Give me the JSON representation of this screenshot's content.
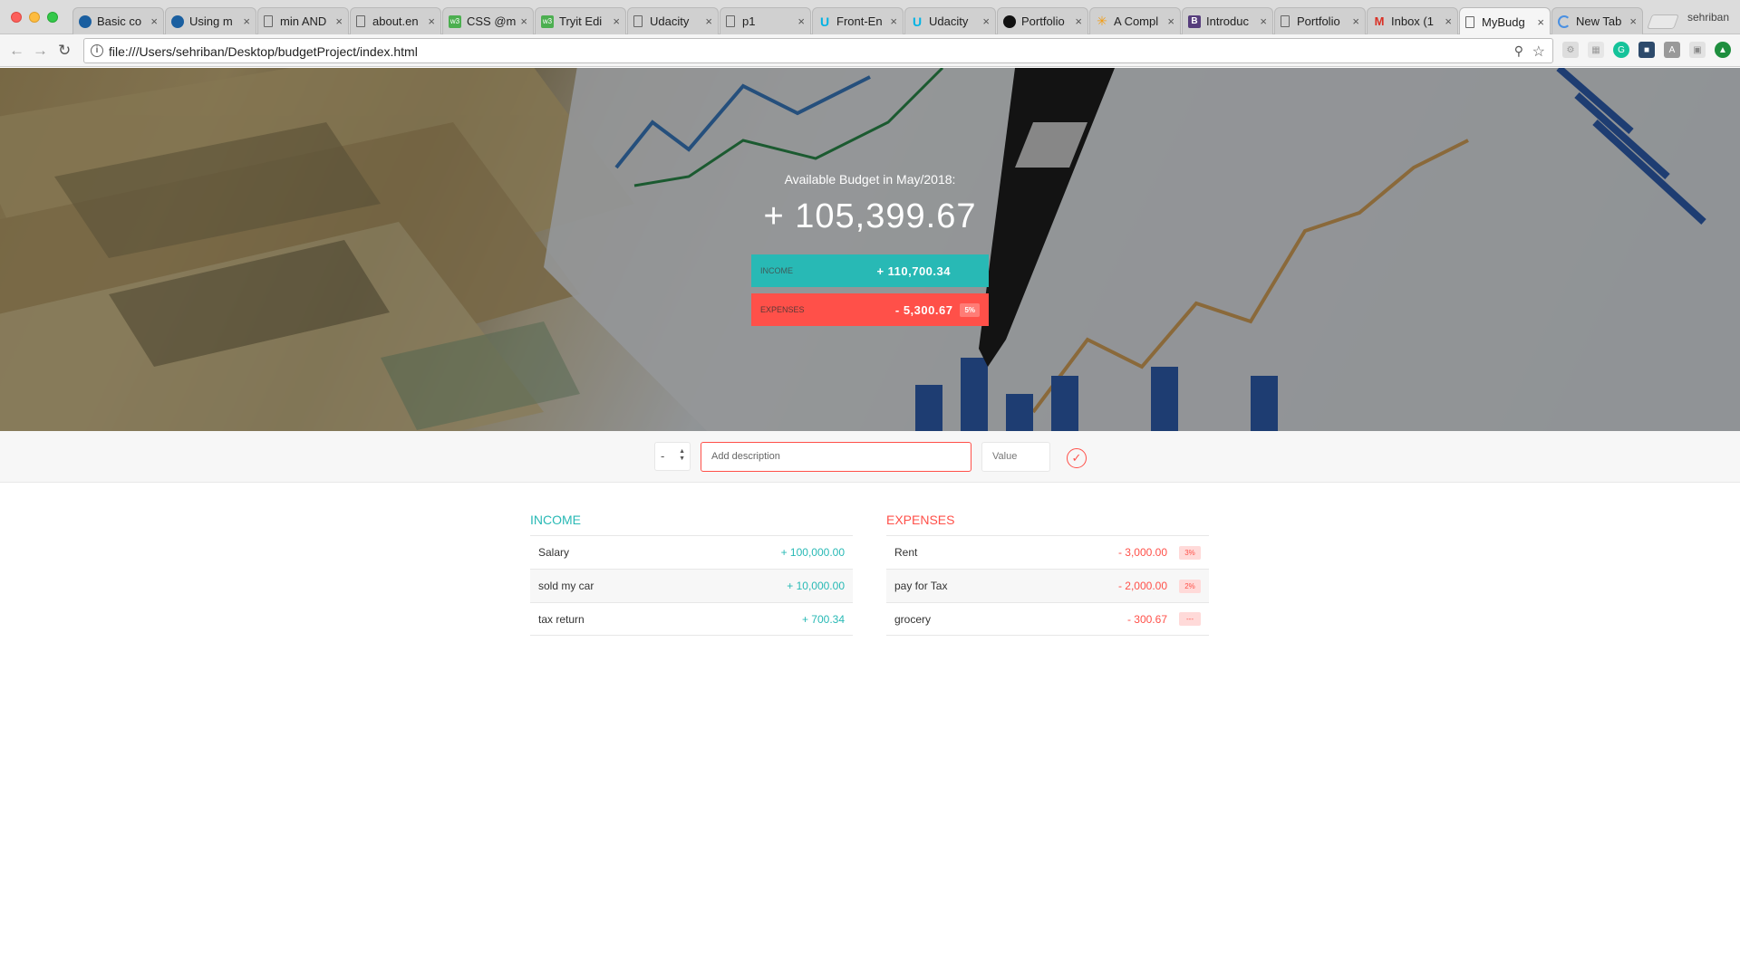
{
  "browser": {
    "tabs": [
      {
        "title": "Basic co",
        "icon": "bird-icon"
      },
      {
        "title": "Using m",
        "icon": "bird-icon"
      },
      {
        "title": "min AND",
        "icon": "document-icon"
      },
      {
        "title": "about.en",
        "icon": "document-icon"
      },
      {
        "title": "CSS @m",
        "icon": "w3schools-icon"
      },
      {
        "title": "Tryit Edi",
        "icon": "w3schools-icon"
      },
      {
        "title": "Udacity",
        "icon": "document-icon"
      },
      {
        "title": "p1",
        "icon": "document-icon"
      },
      {
        "title": "Front-En",
        "icon": "udacity-icon"
      },
      {
        "title": "Udacity",
        "icon": "udacity-icon"
      },
      {
        "title": "Portfolio",
        "icon": "github-icon"
      },
      {
        "title": "A Compl",
        "icon": "star-icon"
      },
      {
        "title": "Introduc",
        "icon": "bootstrap-icon"
      },
      {
        "title": "Portfolio",
        "icon": "document-icon"
      },
      {
        "title": "Inbox (1",
        "icon": "gmail-icon"
      },
      {
        "title": "MyBudg",
        "icon": "document-icon",
        "active": true
      },
      {
        "title": "New Tab",
        "icon": "loading-icon"
      }
    ],
    "profile_name": "sehriban",
    "url": "file:///Users/sehriban/Desktop/budgetProject/index.html"
  },
  "header": {
    "title": "Available Budget in May/2018:",
    "budget": "+ 105,399.67",
    "income_label": "Income",
    "income_value": "+ 110,700.34",
    "expenses_label": "Expenses",
    "expenses_value": "- 5,300.67",
    "expenses_percentage": "5%"
  },
  "add_form": {
    "type_value": "-",
    "description_placeholder": "Add description",
    "value_placeholder": "Value"
  },
  "income": {
    "title": "Income",
    "items": [
      {
        "description": "Salary",
        "value": "+ 100,000.00"
      },
      {
        "description": "sold my car",
        "value": "+ 10,000.00"
      },
      {
        "description": "tax return",
        "value": "+ 700.34"
      }
    ]
  },
  "expenses": {
    "title": "Expenses",
    "items": [
      {
        "description": "Rent",
        "value": "- 3,000.00",
        "percentage": "3%"
      },
      {
        "description": "pay for Tax",
        "value": "- 2,000.00",
        "percentage": "2%"
      },
      {
        "description": "grocery",
        "value": "- 300.67",
        "percentage": "---"
      }
    ]
  },
  "colors": {
    "income": "#28b9b5",
    "expenses": "#ff5049"
  }
}
